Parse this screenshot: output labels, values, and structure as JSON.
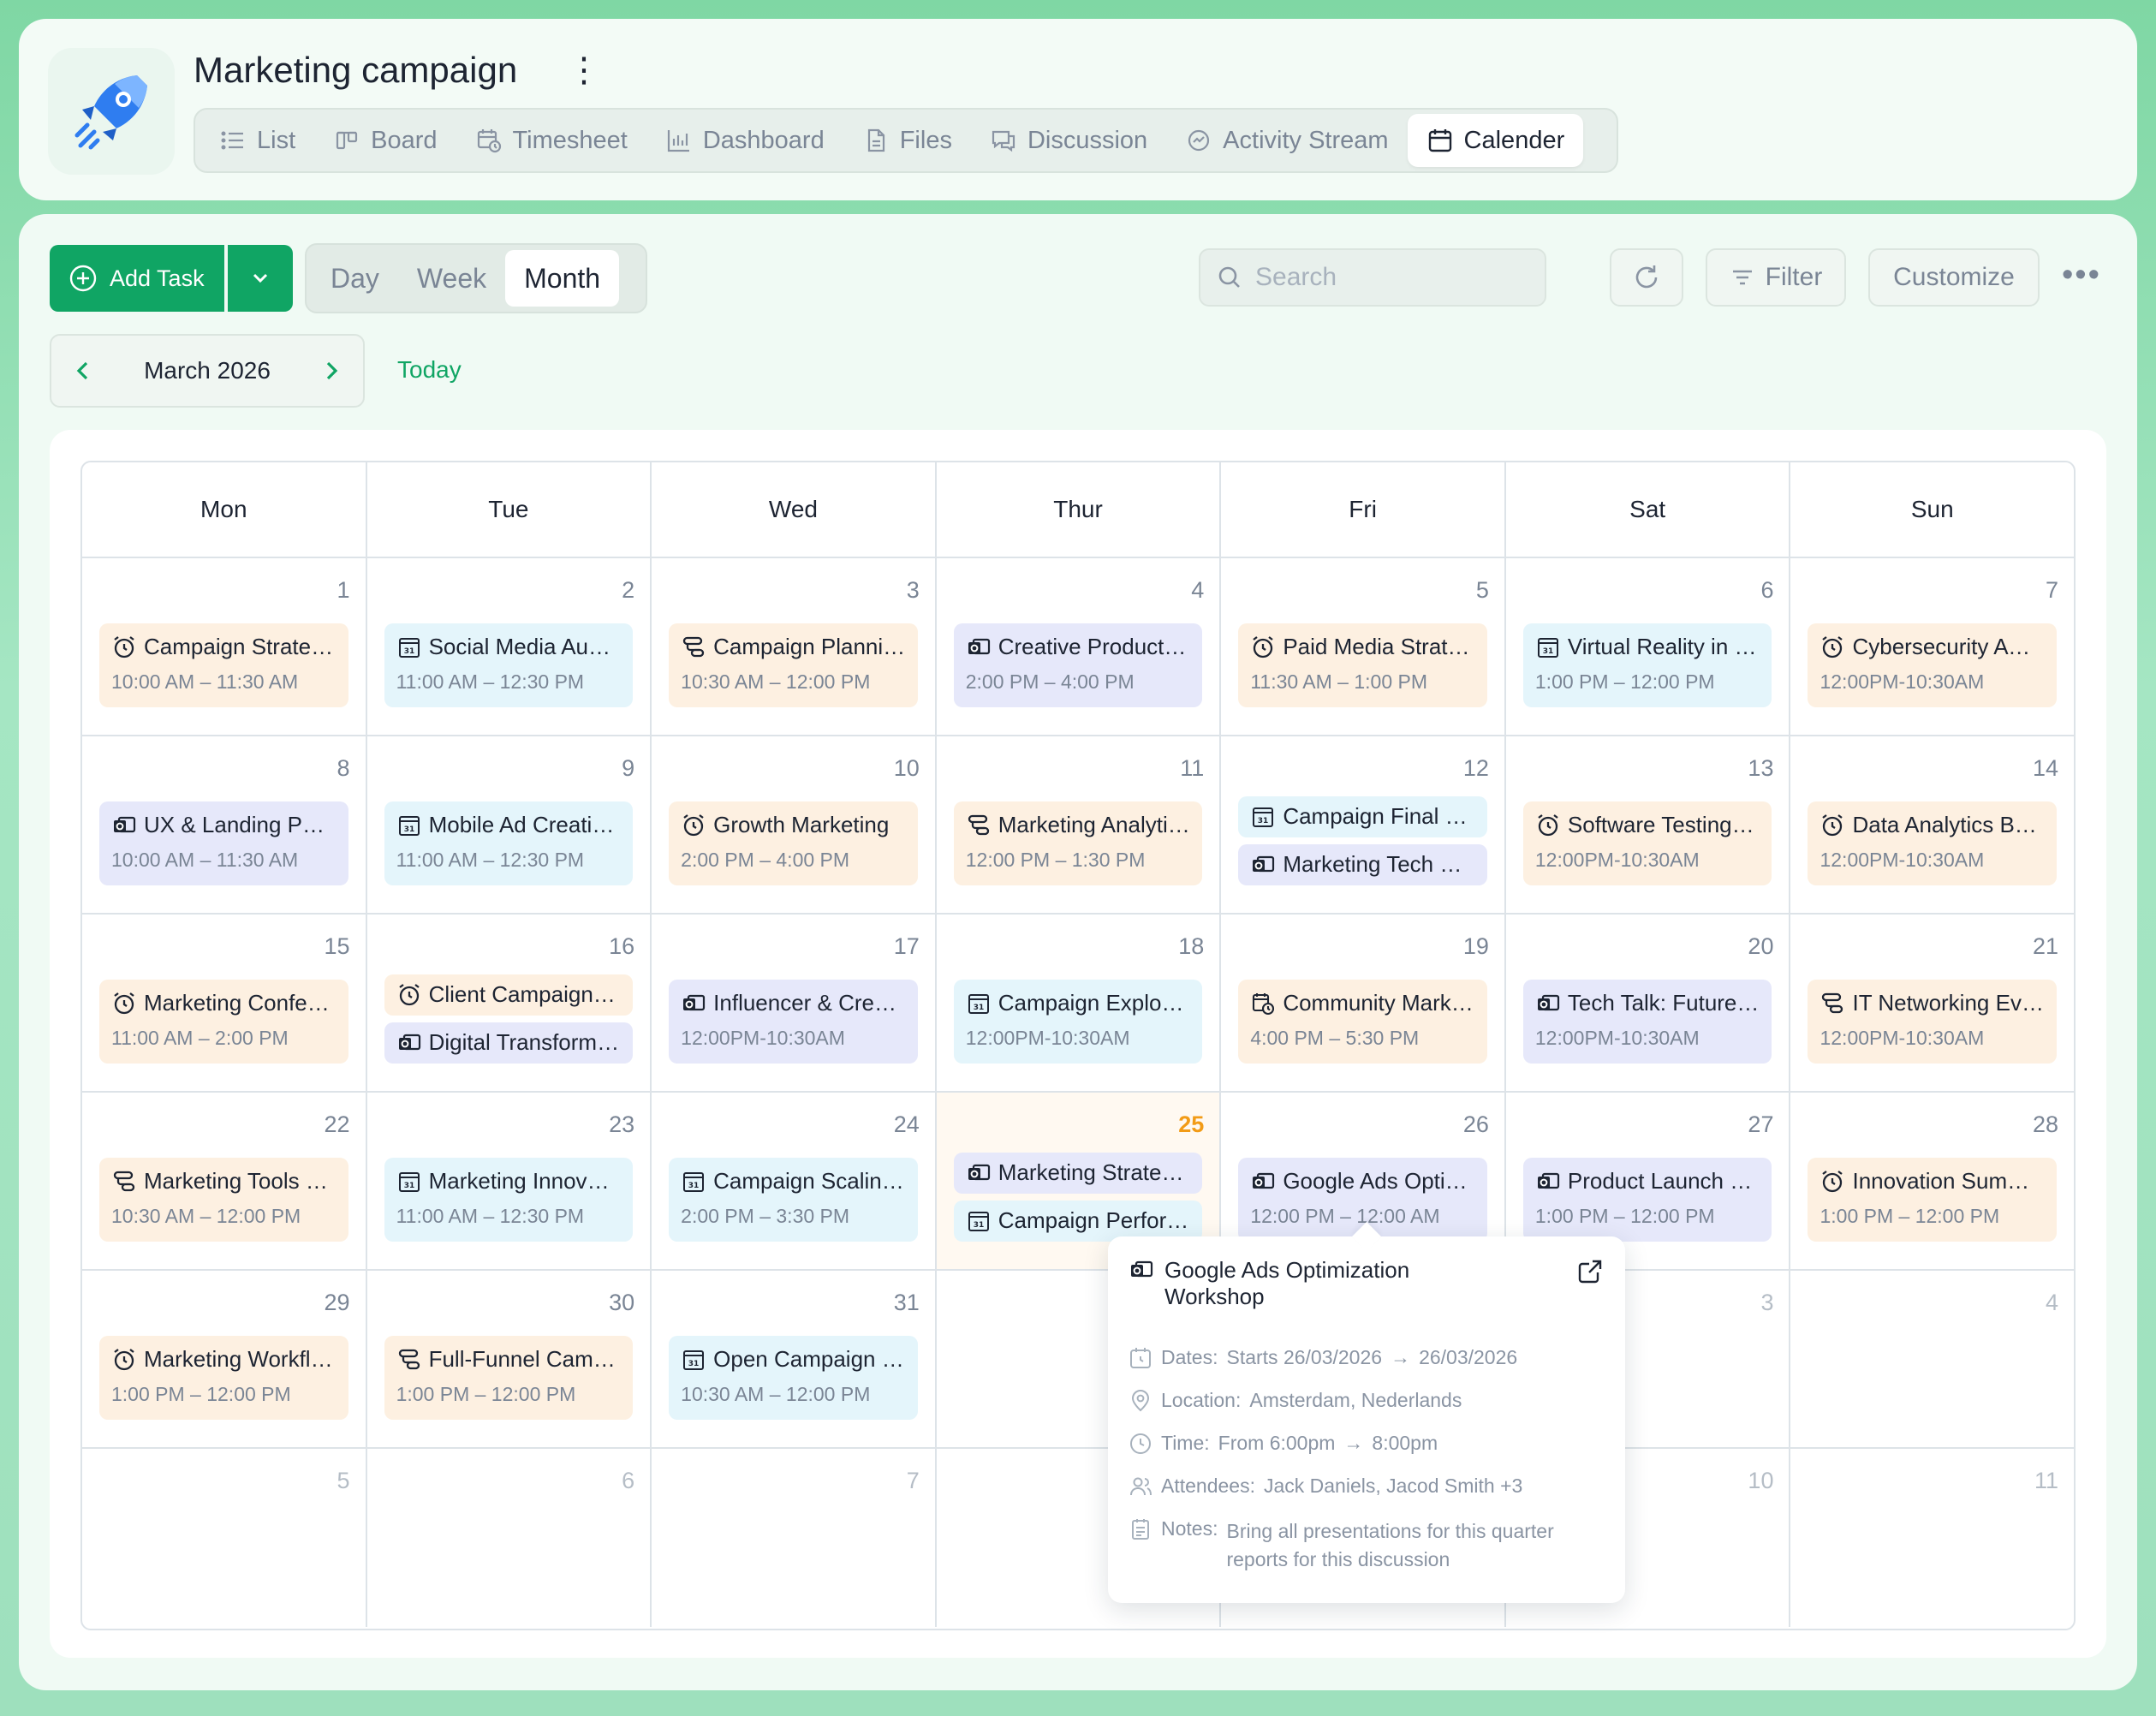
{
  "project": {
    "title": "Marketing campaign",
    "menu_icon": "kebab-icon",
    "logo_icon": "rocket-icon"
  },
  "tabs": [
    {
      "label": "List",
      "icon": "list-icon"
    },
    {
      "label": "Board",
      "icon": "board-icon"
    },
    {
      "label": "Timesheet",
      "icon": "timesheet-icon"
    },
    {
      "label": "Dashboard",
      "icon": "dashboard-icon"
    },
    {
      "label": "Files",
      "icon": "file-icon"
    },
    {
      "label": "Discussion",
      "icon": "discussion-icon"
    },
    {
      "label": "Activity Stream",
      "icon": "activity-icon"
    },
    {
      "label": "Calender",
      "icon": "calendar-icon",
      "active": true
    }
  ],
  "toolbar": {
    "add_task": "Add Task",
    "views": [
      "Day",
      "Week",
      "Month"
    ],
    "active_view": "Month",
    "search_placeholder": "Search",
    "filter": "Filter",
    "customize": "Customize"
  },
  "nav": {
    "month": "March 2026",
    "today": "Today"
  },
  "days_of_week": [
    "Mon",
    "Tue",
    "Wed",
    "Thur",
    "Fri",
    "Sat",
    "Sun"
  ],
  "weeks": [
    [
      {
        "day": "1",
        "events": [
          {
            "title": "Campaign Strateg...",
            "time": "10:00 AM – 11:30 AM",
            "color": "orange",
            "icon": "alarm-icon"
          }
        ]
      },
      {
        "day": "2",
        "events": [
          {
            "title": "Social Media Audit...",
            "time": "11:00 AM – 12:30 PM",
            "color": "blue",
            "icon": "calendar31-icon"
          }
        ]
      },
      {
        "day": "3",
        "events": [
          {
            "title": "Campaign Planning",
            "time": "10:30 AM – 12:00 PM",
            "color": "orange",
            "icon": "workflow-icon"
          }
        ]
      },
      {
        "day": "4",
        "events": [
          {
            "title": "Creative Production",
            "time": "2:00 PM – 4:00 PM",
            "color": "purple",
            "icon": "outlook-icon"
          }
        ]
      },
      {
        "day": "5",
        "events": [
          {
            "title": "Paid Media Strateg...",
            "time": "11:30 AM – 1:00 PM",
            "color": "orange",
            "icon": "alarm-icon"
          }
        ]
      },
      {
        "day": "6",
        "events": [
          {
            "title": "Virtual Reality in Bu...",
            "time": "1:00 PM – 12:00 PM",
            "color": "blue",
            "icon": "calendar31-icon"
          }
        ]
      },
      {
        "day": "7",
        "events": [
          {
            "title": "Cybersecurity Awa...",
            "time": "12:00PM-10:30AM",
            "color": "orange",
            "icon": "alarm-icon"
          }
        ]
      }
    ],
    [
      {
        "day": "8",
        "events": [
          {
            "title": "UX & Landing Page...",
            "time": "10:00 AM – 11:30 AM",
            "color": "purple",
            "icon": "outlook-icon"
          }
        ]
      },
      {
        "day": "9",
        "events": [
          {
            "title": "Mobile Ad Creative...",
            "time": "11:00 AM – 12:30 PM",
            "color": "blue",
            "icon": "calendar31-icon"
          }
        ]
      },
      {
        "day": "10",
        "events": [
          {
            "title": "Growth Marketing",
            "time": "2:00 PM – 4:00 PM",
            "color": "orange",
            "icon": "alarm-icon"
          }
        ]
      },
      {
        "day": "11",
        "events": [
          {
            "title": "Marketing Analytic...",
            "time": "12:00 PM – 1:30 PM",
            "color": "orange",
            "icon": "workflow-icon"
          }
        ]
      },
      {
        "day": "12",
        "events": [
          {
            "title": "Campaign Final QA...",
            "color": "blue",
            "icon": "calendar31-icon",
            "compact": true
          },
          {
            "title": "Marketing Tech Sy...",
            "color": "purple",
            "icon": "outlook-icon",
            "compact": true
          }
        ]
      },
      {
        "day": "13",
        "events": [
          {
            "title": "Software Testing S...",
            "time": "12:00PM-10:30AM",
            "color": "orange",
            "icon": "alarm-icon"
          }
        ]
      },
      {
        "day": "14",
        "events": [
          {
            "title": "Data Analytics Boo...",
            "time": "12:00PM-10:30AM",
            "color": "orange",
            "icon": "alarm-icon"
          }
        ]
      }
    ],
    [
      {
        "day": "15",
        "events": [
          {
            "title": "Marketing Confere...",
            "time": "11:00 AM – 2:00 PM",
            "color": "orange",
            "icon": "alarm-icon"
          }
        ]
      },
      {
        "day": "16",
        "events": [
          {
            "title": "Client Campaign Pl...",
            "color": "orange",
            "icon": "alarm-icon",
            "compact": true
          },
          {
            "title": "Digital Transformat...",
            "color": "purple",
            "icon": "outlook-icon",
            "compact": true
          }
        ]
      },
      {
        "day": "17",
        "events": [
          {
            "title": "Influencer & Creat...",
            "time": "12:00PM-10:30AM",
            "color": "purple",
            "icon": "outlook-icon"
          }
        ]
      },
      {
        "day": "18",
        "events": [
          {
            "title": "Campaign Explora...",
            "time": "12:00PM-10:30AM",
            "color": "blue",
            "icon": "calendar31-icon"
          }
        ]
      },
      {
        "day": "19",
        "events": [
          {
            "title": "Community Market...",
            "time": "4:00 PM – 5:30 PM",
            "color": "orange",
            "icon": "calendar-clock-icon"
          }
        ]
      },
      {
        "day": "20",
        "events": [
          {
            "title": "Tech Talk: Future of...",
            "time": "12:00PM-10:30AM",
            "color": "purple",
            "icon": "outlook-icon"
          }
        ]
      },
      {
        "day": "21",
        "events": [
          {
            "title": "IT Networking Event",
            "time": "12:00PM-10:30AM",
            "color": "orange",
            "icon": "workflow-icon"
          }
        ]
      }
    ],
    [
      {
        "day": "22",
        "events": [
          {
            "title": "Marketing Tools Re...",
            "time": "10:30 AM – 12:00 PM",
            "color": "orange",
            "icon": "workflow-icon"
          }
        ]
      },
      {
        "day": "23",
        "events": [
          {
            "title": "Marketing Innovati...",
            "time": "11:00 AM – 12:30 PM",
            "color": "blue",
            "icon": "calendar31-icon"
          }
        ]
      },
      {
        "day": "24",
        "events": [
          {
            "title": "Campaign Scaling...",
            "time": "2:00 PM – 3:30 PM",
            "color": "blue",
            "icon": "calendar31-icon"
          }
        ]
      },
      {
        "day": "25",
        "today": true,
        "events": [
          {
            "title": "Marketing Strategy...",
            "color": "purple",
            "icon": "outlook-icon",
            "compact": true
          },
          {
            "title": "Campaign Perform...",
            "color": "blue",
            "icon": "calendar31-icon",
            "compact": true
          }
        ]
      },
      {
        "day": "26",
        "events": [
          {
            "title": "Google Ads Optimi...",
            "time": "12:00 PM – 12:00 AM",
            "color": "purple",
            "icon": "outlook-icon"
          }
        ]
      },
      {
        "day": "27",
        "events": [
          {
            "title": "Product Launch Ev...",
            "time": "1:00 PM – 12:00 PM",
            "color": "purple",
            "icon": "outlook-icon"
          }
        ]
      },
      {
        "day": "28",
        "events": [
          {
            "title": "Innovation Summit...",
            "time": "1:00 PM – 12:00 PM",
            "color": "orange",
            "icon": "alarm-icon"
          }
        ]
      }
    ],
    [
      {
        "day": "29",
        "events": [
          {
            "title": "Marketing Workflo...",
            "time": "1:00 PM – 12:00 PM",
            "color": "orange",
            "icon": "alarm-icon"
          }
        ]
      },
      {
        "day": "30",
        "events": [
          {
            "title": "Full-Funnel Campa...",
            "time": "1:00 PM – 12:00 PM",
            "color": "orange",
            "icon": "workflow-icon"
          }
        ]
      },
      {
        "day": "31",
        "events": [
          {
            "title": "Open Campaign E...",
            "time": "10:30 AM – 12:00 PM",
            "color": "blue",
            "icon": "calendar31-icon"
          }
        ]
      },
      {
        "day": "",
        "other": true,
        "events": []
      },
      {
        "day": "",
        "other": true,
        "events": []
      },
      {
        "day": "3",
        "other": true,
        "events": []
      },
      {
        "day": "4",
        "other": true,
        "events": []
      }
    ],
    [
      {
        "day": "5",
        "other": true,
        "events": []
      },
      {
        "day": "6",
        "other": true,
        "events": []
      },
      {
        "day": "7",
        "other": true,
        "events": []
      },
      {
        "day": "",
        "other": true,
        "events": []
      },
      {
        "day": "",
        "other": true,
        "events": []
      },
      {
        "day": "10",
        "other": true,
        "events": []
      },
      {
        "day": "11",
        "other": true,
        "events": []
      }
    ]
  ],
  "popover": {
    "title": "Google Ads Optimization Workshop",
    "dates_label": "Dates:",
    "dates_start": "Starts 26/03/2026",
    "dates_end": "26/03/2026",
    "location_label": "Location:",
    "location": "Amsterdam, Nederlands",
    "time_label": "Time:",
    "time_start": "From 6:00pm",
    "time_end": "8:00pm",
    "attendees_label": "Attendees:",
    "attendees": "Jack Daniels, Jacod Smith +3",
    "notes_label": "Notes:",
    "notes": "Bring all presentations for this quarter reports for this discussion"
  }
}
